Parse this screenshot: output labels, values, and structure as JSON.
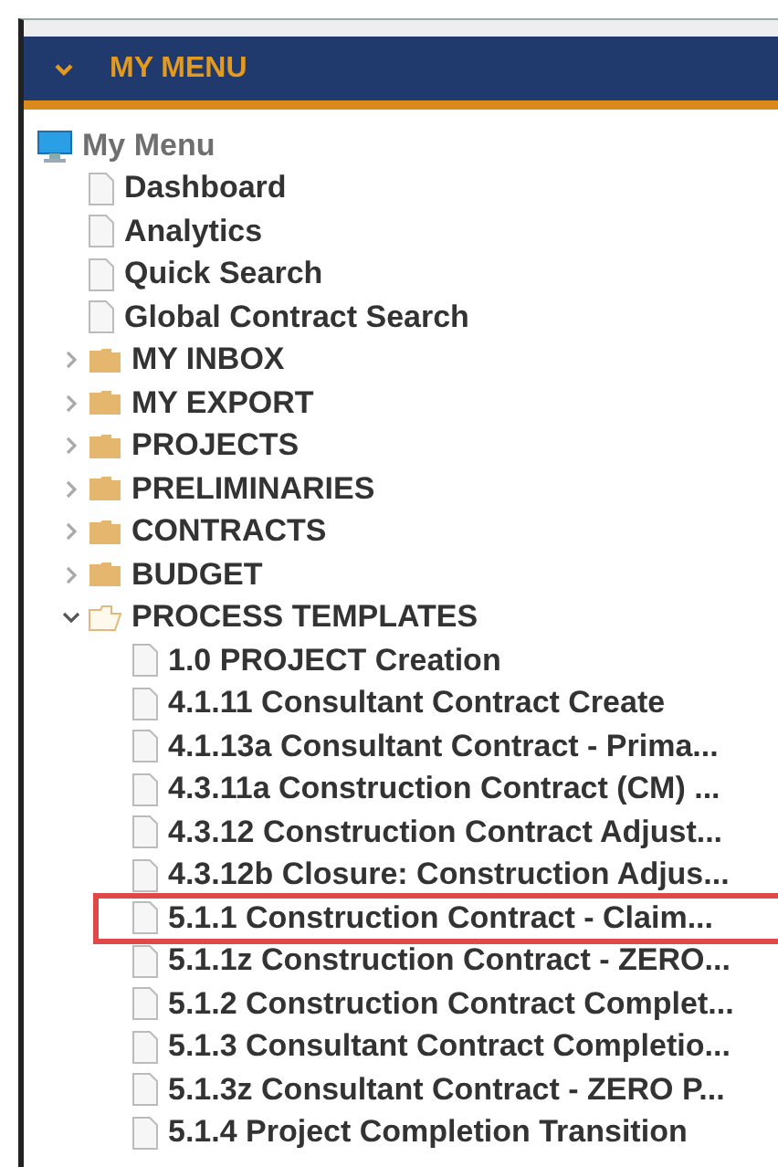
{
  "panel": {
    "title": "MY MENU",
    "expanded": true
  },
  "tree": [
    {
      "label": "My Menu",
      "kind": "root",
      "children": [
        {
          "label": "Dashboard",
          "kind": "page"
        },
        {
          "label": "Analytics",
          "kind": "page"
        },
        {
          "label": "Quick Search",
          "kind": "page"
        },
        {
          "label": "Global Contract Search",
          "kind": "page"
        },
        {
          "label": "MY INBOX",
          "kind": "folder",
          "expanded": false
        },
        {
          "label": "MY EXPORT",
          "kind": "folder",
          "expanded": false
        },
        {
          "label": "PROJECTS",
          "kind": "folder",
          "expanded": false
        },
        {
          "label": "PRELIMINARIES",
          "kind": "folder",
          "expanded": false
        },
        {
          "label": "CONTRACTS",
          "kind": "folder",
          "expanded": false
        },
        {
          "label": "BUDGET",
          "kind": "folder",
          "expanded": false
        },
        {
          "label": "PROCESS TEMPLATES",
          "kind": "folder",
          "expanded": true,
          "children": [
            {
              "label": "1.0 PROJECT Creation",
              "kind": "page",
              "selected": false
            },
            {
              "label": "4.1.11 Consultant Contract Create",
              "kind": "page",
              "selected": false
            },
            {
              "label": "4.1.13a Consultant Contract - Prima...",
              "kind": "page",
              "selected": false
            },
            {
              "label": "4.3.11a Construction Contract (CM) ...",
              "kind": "page",
              "selected": false
            },
            {
              "label": "4.3.12 Construction Contract Adjust...",
              "kind": "page",
              "selected": false
            },
            {
              "label": "4.3.12b Closure: Construction Adjus...",
              "kind": "page",
              "selected": false
            },
            {
              "label": "5.1.1 Construction Contract - Claim...",
              "kind": "page",
              "selected": true
            },
            {
              "label": "5.1.1z Construction Contract - ZERO...",
              "kind": "page",
              "selected": false
            },
            {
              "label": "5.1.2 Construction Contract Complet...",
              "kind": "page",
              "selected": false
            },
            {
              "label": "5.1.3 Consultant Contract Completio...",
              "kind": "page",
              "selected": false
            },
            {
              "label": "5.1.3z Consultant Contract - ZERO P...",
              "kind": "page",
              "selected": false
            },
            {
              "label": "5.1.4 Project Completion Transition",
              "kind": "page",
              "selected": false
            }
          ]
        }
      ]
    }
  ]
}
